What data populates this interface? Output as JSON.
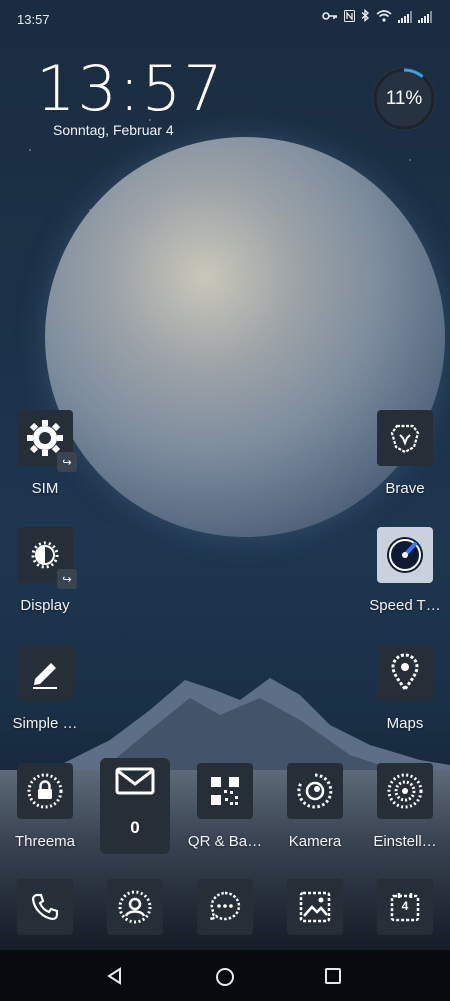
{
  "status_bar": {
    "time": "13:57",
    "icons": [
      "key-icon",
      "nfc-icon",
      "bluetooth-icon",
      "wifi-icon",
      "signal-icon",
      "signal-icon"
    ]
  },
  "clock_widget": {
    "time": "13:57",
    "date": "Sonntag, Februar 4"
  },
  "battery_widget": {
    "percent_label": "11%",
    "level": 0.11,
    "accent": "#3aa0e8"
  },
  "apps": {
    "sim": {
      "label": "SIM",
      "icon": "gear-icon"
    },
    "brave": {
      "label": "Brave",
      "icon": "lion-icon"
    },
    "display": {
      "label": "Display",
      "icon": "brightness-icon"
    },
    "speed_test": {
      "label": "Speed T…",
      "icon": "speedometer-icon"
    },
    "simple_notes": {
      "label": "Simple …",
      "icon": "pencil-icon"
    },
    "maps": {
      "label": "Maps",
      "icon": "location-pin-icon"
    },
    "threema": {
      "label": "Threema",
      "icon": "lock-icon"
    },
    "mail": {
      "count": "0",
      "icon": "envelope-icon"
    },
    "qr": {
      "label": "QR & Ba…",
      "icon": "qr-code-icon"
    },
    "kamera": {
      "label": "Kamera",
      "icon": "camera-icon"
    },
    "einstellungen": {
      "label": "Einstell…",
      "icon": "settings-icon"
    }
  },
  "dock": {
    "items": [
      "phone-icon",
      "contacts-icon",
      "messages-icon",
      "gallery-icon",
      "calendar-icon"
    ],
    "calendar_day": "4"
  },
  "nav": [
    "back-icon",
    "home-icon",
    "recents-icon"
  ]
}
